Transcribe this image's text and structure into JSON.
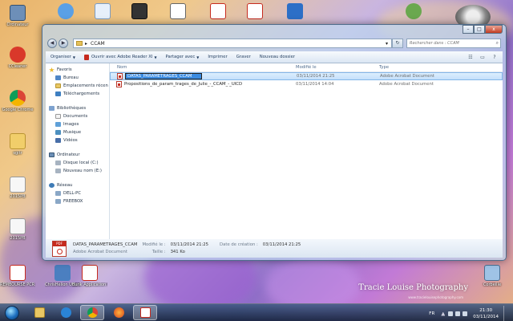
{
  "desktop": {
    "icons": [
      {
        "label": "Ordinateur"
      },
      {
        "label": "CCleaner"
      },
      {
        "label": "Google Chrome"
      },
      {
        "label": "sgitr"
      },
      {
        "label": "2015PB"
      },
      {
        "label": "2015PB"
      },
      {
        "label": "REMBOURSE PCR..."
      },
      {
        "label": "ChrisHelion Utils Energie"
      },
      {
        "label": "Bunk Application Bérard"
      },
      {
        "label": "Corbeille"
      }
    ],
    "photo_credit": "Tracie Louise Photography",
    "photo_url": "www.tracielouisephotography.com"
  },
  "window": {
    "controls": {
      "minimize": "–",
      "maximize": "□",
      "close": "x"
    },
    "address": {
      "separator": "▸",
      "current": "CCAM",
      "chevron": "▾"
    },
    "search": {
      "placeholder": "Rechercher dans : CCAM",
      "icon": "search-icon"
    },
    "toolbar": {
      "organize": "Organiser",
      "open_with": "Ouvrir avec Adobe Reader XI",
      "share": "Partager avec",
      "print": "Imprimer",
      "burn": "Graver",
      "new_folder": "Nouveau dossier"
    },
    "nav": {
      "favorites": {
        "title": "Favoris",
        "items": [
          "Bureau",
          "Emplacements récen",
          "Téléchargements"
        ]
      },
      "libraries": {
        "title": "Bibliothèques",
        "items": [
          "Documents",
          "Images",
          "Musique",
          "Vidéos"
        ]
      },
      "computer": {
        "title": "Ordinateur",
        "items": [
          "Disque local (C:)",
          "Nouveau nom (E:)"
        ]
      },
      "network": {
        "title": "Réseau",
        "items": [
          "DELL-PC",
          "FREEBOX"
        ]
      }
    },
    "columns": {
      "name": "Nom",
      "date": "Modifié le",
      "type": "Type"
    },
    "files": [
      {
        "name": "DATAS_PARAMETRAGES_CCAM",
        "date": "03/11/2014 21:25",
        "type": "Adobe Acrobat Document",
        "selected": true
      },
      {
        "name": "Propositions_de_param_trages_de_Julie_-_CCAM_-_UICD",
        "date": "03/11/2014 14:04",
        "type": "Adobe Acrobat Document",
        "selected": false
      }
    ],
    "details": {
      "filename": "DATAS_PARAMETRAGES_CCAM",
      "filetype": "Adobe Acrobat Document",
      "modified_label": "Modifié le :",
      "modified_value": "03/11/2014 21:25",
      "size_label": "Taille :",
      "size_value": "341 Ko",
      "created_label": "Date de création :",
      "created_value": "03/11/2014 21:25",
      "badge": "PDF"
    }
  },
  "taskbar": {
    "language": "FR",
    "time": "21:30",
    "date": "03/11/2014"
  },
  "colors": {
    "selection": "#c4e0fb",
    "pdf_red": "#c62a1e",
    "link_blue": "#1e395b"
  }
}
